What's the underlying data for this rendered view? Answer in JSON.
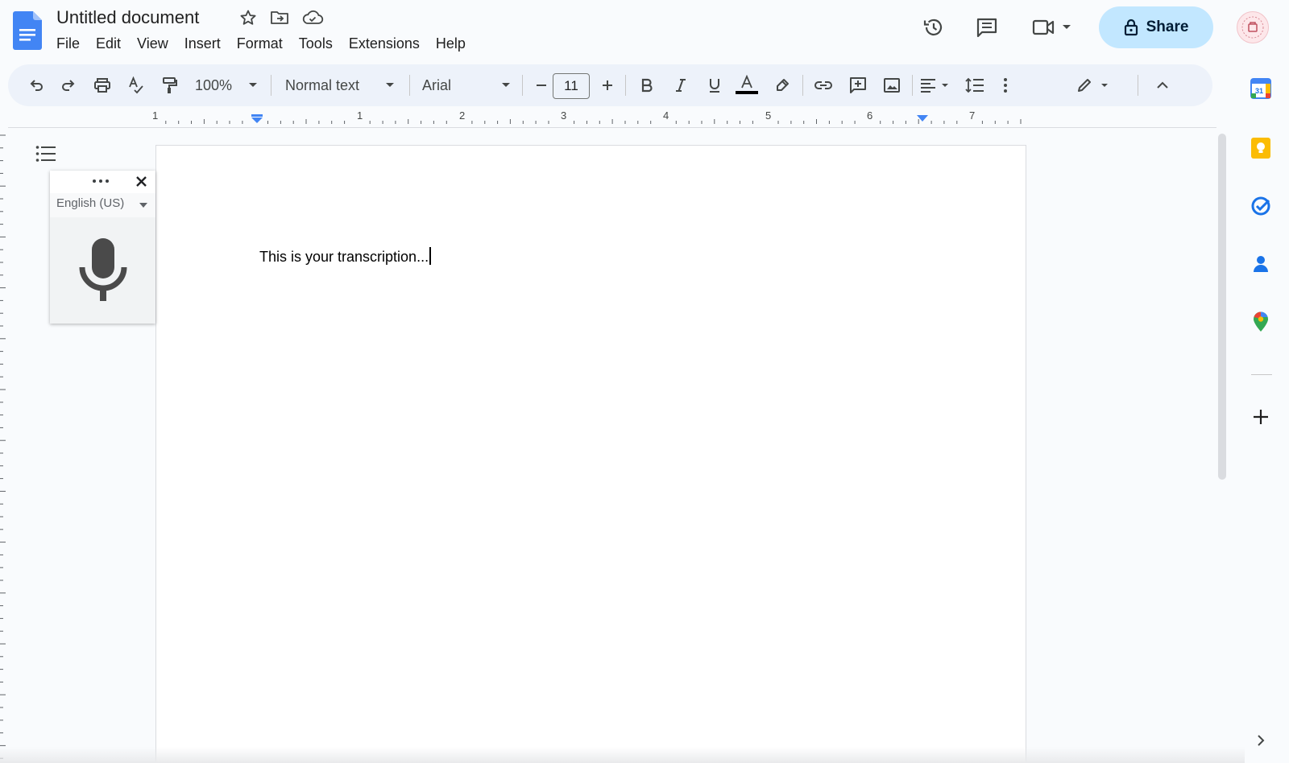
{
  "app": {
    "title": "Untitled document",
    "brand_color": "#4285f4"
  },
  "menu": [
    "File",
    "Edit",
    "View",
    "Insert",
    "Format",
    "Tools",
    "Extensions",
    "Help"
  ],
  "header": {
    "share_label": "Share",
    "share_bg": "#c2e7ff"
  },
  "toolbar": {
    "zoom": "100%",
    "style": "Normal text",
    "font": "Arial",
    "font_size": "11"
  },
  "ruler": {
    "labels": [
      "1",
      "1",
      "2",
      "3",
      "4",
      "5",
      "6",
      "7"
    ]
  },
  "document": {
    "text": "This is your transcription..."
  },
  "voice_typing": {
    "language": "English (US)"
  },
  "side_panel": {
    "calendar_day": "31"
  }
}
